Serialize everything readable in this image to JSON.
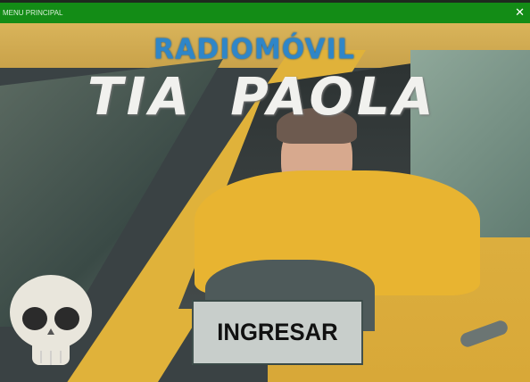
{
  "window": {
    "title": "MENU PRINCIPAL",
    "close_icon": "close-icon"
  },
  "hero": {
    "subtitle": "RADIOMÓVIL",
    "title": "TIA PAOLA"
  },
  "actions": {
    "enter_label": "INGRESAR"
  },
  "decor": {
    "skull_icon": "skull-icon"
  },
  "colors": {
    "titlebar": "#138c16",
    "subtitle": "#2f86c8",
    "taxi_yellow": "#e3b83a"
  }
}
